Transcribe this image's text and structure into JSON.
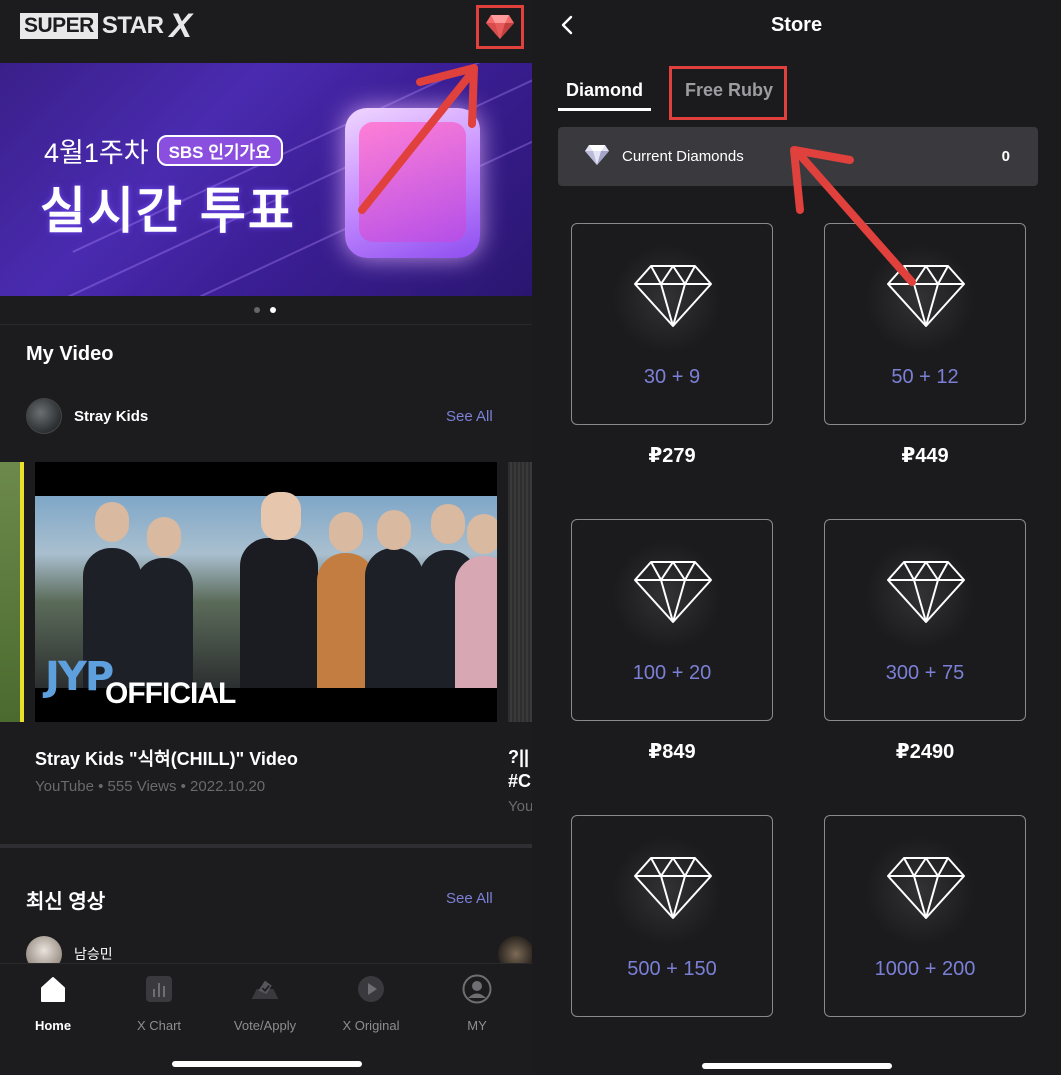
{
  "left": {
    "logo": {
      "box_text": "SUPER",
      "star_text": "STAR",
      "x_text": "X"
    },
    "banner": {
      "week": "4월1주차",
      "pill": "SBS 인기가요",
      "title": "실시간 투표"
    },
    "my_video": {
      "title": "My Video",
      "artist": "Stray Kids",
      "see_all": "See All",
      "video_title": "Stray Kids \"식혀(CHILL)\" Video",
      "video_meta": "YouTube • 555 Views • 2022.10.20",
      "thumb_brand": "JYP",
      "thumb_caption": "OFFICIAL",
      "side_title_1": "?||",
      "side_title_2": "#C",
      "side_meta": "You"
    },
    "latest": {
      "title": "최신 영상",
      "see_all": "See All",
      "person": "남승민"
    },
    "tabs": [
      {
        "label": "Home",
        "icon": "home-icon",
        "active": true
      },
      {
        "label": "X Chart",
        "icon": "chart-icon",
        "active": false
      },
      {
        "label": "Vote/Apply",
        "icon": "vote-icon",
        "active": false
      },
      {
        "label": "X Original",
        "icon": "play-icon",
        "active": false
      },
      {
        "label": "MY",
        "icon": "profile-icon",
        "active": false
      }
    ]
  },
  "right": {
    "header_title": "Store",
    "tabs": {
      "diamond": "Diamond",
      "free_ruby": "Free Ruby"
    },
    "current": {
      "label": "Current Diamonds",
      "value": "0"
    },
    "packages": [
      {
        "amount": "30 + 9",
        "price": "₽279"
      },
      {
        "amount": "50 + 12",
        "price": "₽449"
      },
      {
        "amount": "100 + 20",
        "price": "₽849"
      },
      {
        "amount": "300 + 75",
        "price": "₽2490"
      },
      {
        "amount": "500 + 150",
        "price": ""
      },
      {
        "amount": "1000 + 200",
        "price": ""
      }
    ]
  },
  "colors": {
    "highlight": "#e0413c",
    "accent": "#7b80d6",
    "background": "#1b1b1d"
  }
}
